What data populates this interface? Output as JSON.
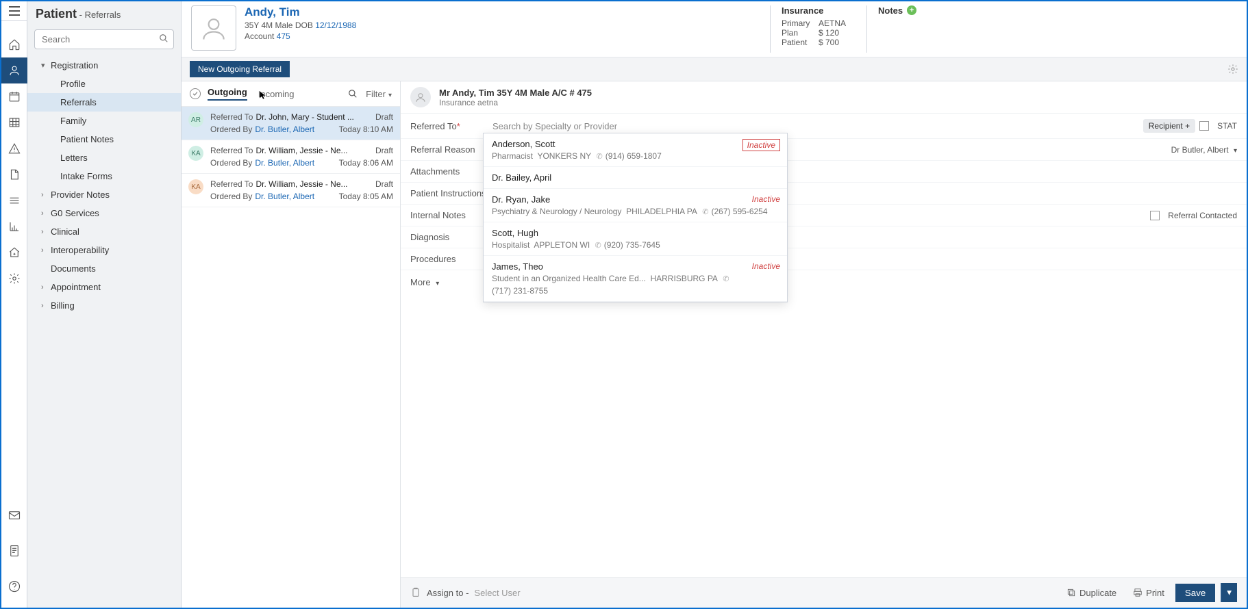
{
  "breadcrumb": {
    "main": "Patient",
    "sub": "- Referrals"
  },
  "search": {
    "placeholder": "Search"
  },
  "sidebar": {
    "sections": [
      {
        "label": "Registration",
        "open": true,
        "items": [
          {
            "label": "Profile"
          },
          {
            "label": "Referrals",
            "active": true
          },
          {
            "label": "Family"
          },
          {
            "label": "Patient Notes"
          },
          {
            "label": "Letters"
          },
          {
            "label": "Intake Forms"
          }
        ]
      },
      {
        "label": "Provider Notes",
        "open": false
      },
      {
        "label": "G0 Services",
        "open": false
      },
      {
        "label": "Clinical",
        "open": false
      },
      {
        "label": "Interoperability",
        "open": false
      },
      {
        "label": "Documents",
        "open": false,
        "leaf": true
      },
      {
        "label": "Appointment",
        "open": false
      },
      {
        "label": "Billing",
        "open": false
      }
    ]
  },
  "patient": {
    "name": "Andy, Tim",
    "age_sex": "35Y 4M Male",
    "dob_lbl": "DOB",
    "dob": "12/12/1988",
    "acct_lbl": "Account",
    "acct": "475"
  },
  "insurance": {
    "title": "Insurance",
    "rows": [
      {
        "l": "Primary",
        "v": "AETNA"
      },
      {
        "l": "Plan",
        "v": "$ 120"
      },
      {
        "l": "Patient",
        "v": "$ 700"
      }
    ]
  },
  "notes": {
    "title": "Notes"
  },
  "toolbar": {
    "new_btn": "New Outgoing Referral"
  },
  "list": {
    "tabs": {
      "outgoing": "Outgoing",
      "incoming": "Incoming"
    },
    "filter": "Filter",
    "items": [
      {
        "badge": "AR",
        "badge_class": "badge-mint",
        "ref_lbl": "Referred To",
        "ref": "Dr. John, Mary - Student ...",
        "status": "Draft",
        "ord_lbl": "Ordered By",
        "ord": "Dr. Butler, Albert",
        "time": "Today 8:10 AM",
        "selected": true
      },
      {
        "badge": "KA",
        "badge_class": "badge-mint",
        "ref_lbl": "Referred To",
        "ref": "Dr. William, Jessie - Ne...",
        "status": "Draft",
        "ord_lbl": "Ordered By",
        "ord": "Dr. Butler, Albert",
        "time": "Today 8:06 AM"
      },
      {
        "badge": "KA",
        "badge_class": "badge-peach",
        "ref_lbl": "Referred To",
        "ref": "Dr. William, Jessie - Ne...",
        "status": "Draft",
        "ord_lbl": "Ordered By",
        "ord": "Dr. Butler, Albert",
        "time": "Today 8:05 AM"
      }
    ]
  },
  "detail": {
    "header": {
      "t1": "Mr Andy, Tim 35Y 4M Male  A/C # 475",
      "t2": "Insurance aetna"
    },
    "referred_to": {
      "label": "Referred To",
      "placeholder": "Search by Specialty or Provider",
      "recipient": "Recipient",
      "stat": "STAT"
    },
    "reason": {
      "label": "Referral Reason",
      "provider": "Dr Butler, Albert"
    },
    "attachments": {
      "label": "Attachments"
    },
    "instructions": {
      "label": "Patient Instructions"
    },
    "internal_notes": {
      "label": "Internal Notes",
      "contacted": "Referral Contacted"
    },
    "diagnosis": {
      "label": "Diagnosis"
    },
    "procedures": {
      "label": "Procedures"
    },
    "more": "More",
    "dropdown": [
      {
        "name": "Anderson, Scott",
        "role": "Pharmacist",
        "loc": "YONKERS NY",
        "phone": "(914) 659-1807",
        "inactive": true,
        "highlighted": true
      },
      {
        "name": "Dr. Bailey, April"
      },
      {
        "name": "Dr. Ryan, Jake",
        "role": "Psychiatry & Neurology / Neurology",
        "loc": "PHILADELPHIA PA",
        "phone": "(267) 595-6254",
        "inactive": true
      },
      {
        "name": "Scott, Hugh",
        "role": "Hospitalist",
        "loc": "APPLETON WI",
        "phone": "(920) 735-7645"
      },
      {
        "name": "James, Theo",
        "role": "Student in an Organized Health Care Ed...",
        "loc": "HARRISBURG PA",
        "phone": "(717) 231-8755",
        "inactive": true
      }
    ],
    "inactive_label": "Inactive"
  },
  "actions": {
    "assign": "Assign to -",
    "select_user": "Select User",
    "duplicate": "Duplicate",
    "print": "Print",
    "save": "Save"
  }
}
